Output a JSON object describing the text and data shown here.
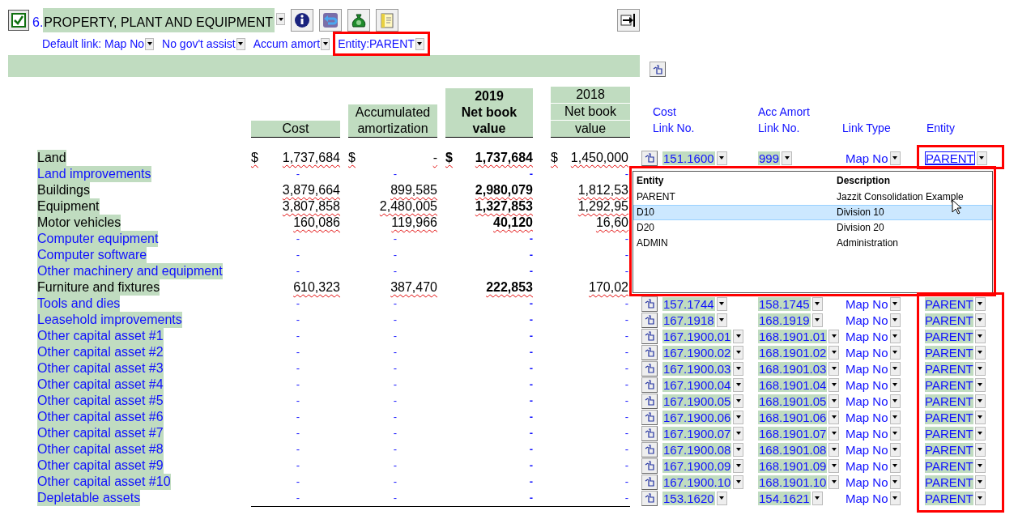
{
  "section": {
    "checked": true,
    "number": "6.",
    "title": "PROPERTY, PLANT AND EQUIPMENT"
  },
  "options": [
    {
      "label": "Default link: Map No",
      "annotated": false
    },
    {
      "label": "No gov't assist",
      "annotated": false
    },
    {
      "label": "Accum amort",
      "annotated": false
    },
    {
      "label": "Entity:PARENT",
      "annotated": true
    }
  ],
  "columns": [
    {
      "kind": "plain",
      "lines": [
        "Cost"
      ]
    },
    {
      "kind": "plain",
      "lines": [
        "Accumulated",
        "amortization"
      ]
    },
    {
      "kind": "current",
      "lines": [
        "2019",
        "Net book",
        "value"
      ]
    },
    {
      "kind": "prior",
      "lines": [
        "2018",
        "Net book",
        "value"
      ]
    }
  ],
  "entity_column_annotated": true,
  "link_columns": [
    {
      "lines": [
        "Cost",
        "Link No."
      ]
    },
    {
      "lines": [
        "Acc Amort",
        "Link No."
      ]
    },
    {
      "lines": [
        "Link Type"
      ]
    },
    {
      "lines": [
        "Entity"
      ]
    }
  ],
  "rows": [
    {
      "name": "Land",
      "filled": true,
      "symbols": [
        "$",
        "$",
        "$",
        "$"
      ],
      "cells": [
        "1,737,684",
        "-",
        "1,737,684",
        "1,450,000"
      ],
      "links": {
        "cost": "151.1600",
        "amort": "999",
        "type": "Map No",
        "entity": "PARENT",
        "focused": true,
        "annotated": true
      }
    },
    {
      "name": "Land improvements",
      "filled": false,
      "cells": [
        "-",
        "-",
        "-",
        "-"
      ]
    },
    {
      "name": "Buildings",
      "filled": true,
      "cells": [
        "3,879,664",
        "899,585",
        "2,980,079",
        "1,812,53"
      ]
    },
    {
      "name": "Equipment",
      "filled": true,
      "cells": [
        "3,807,858",
        "2,480,005",
        "1,327,853",
        "1,292,95"
      ]
    },
    {
      "name": "Motor vehicles",
      "filled": true,
      "cells": [
        "160,086",
        "119,966",
        "40,120",
        "16,60"
      ]
    },
    {
      "name": "Computer equipment",
      "filled": false,
      "cells": [
        "-",
        "-",
        "-",
        "-"
      ]
    },
    {
      "name": "Computer software",
      "filled": false,
      "cells": [
        "-",
        "-",
        "-",
        "-"
      ]
    },
    {
      "name": "Other machinery and equipment",
      "filled": false,
      "cells": [
        "-",
        "-",
        "-",
        "-"
      ]
    },
    {
      "name": "Furniture and fixtures",
      "filled": true,
      "cells": [
        "610,323",
        "387,470",
        "222,853",
        "170,02"
      ]
    },
    {
      "name": "Tools and dies",
      "filled": false,
      "cells": [
        "-",
        "-",
        "-",
        "-"
      ],
      "links": {
        "cost": "157.1744",
        "amort": "158.1745",
        "type": "Map No",
        "entity": "PARENT"
      }
    },
    {
      "name": "Leasehold improvements",
      "filled": false,
      "cells": [
        "-",
        "-",
        "-",
        "-"
      ],
      "links": {
        "cost": "167.1918",
        "amort": "168.1919",
        "type": "Map No",
        "entity": "PARENT"
      }
    },
    {
      "name": "Other capital asset #1",
      "filled": false,
      "cells": [
        "-",
        "-",
        "-",
        "-"
      ],
      "links": {
        "cost": "167.1900.01",
        "amort": "168.1901.01",
        "type": "Map No",
        "entity": "PARENT"
      }
    },
    {
      "name": "Other capital asset #2",
      "filled": false,
      "cells": [
        "-",
        "-",
        "-",
        "-"
      ],
      "links": {
        "cost": "167.1900.02",
        "amort": "168.1901.02",
        "type": "Map No",
        "entity": "PARENT"
      }
    },
    {
      "name": "Other capital asset #3",
      "filled": false,
      "cells": [
        "-",
        "-",
        "-",
        "-"
      ],
      "links": {
        "cost": "167.1900.03",
        "amort": "168.1901.03",
        "type": "Map No",
        "entity": "PARENT"
      }
    },
    {
      "name": "Other capital asset #4",
      "filled": false,
      "cells": [
        "-",
        "-",
        "-",
        "-"
      ],
      "links": {
        "cost": "167.1900.04",
        "amort": "168.1901.04",
        "type": "Map No",
        "entity": "PARENT"
      }
    },
    {
      "name": "Other capital asset #5",
      "filled": false,
      "cells": [
        "-",
        "-",
        "-",
        "-"
      ],
      "links": {
        "cost": "167.1900.05",
        "amort": "168.1901.05",
        "type": "Map No",
        "entity": "PARENT"
      }
    },
    {
      "name": "Other capital asset #6",
      "filled": false,
      "cells": [
        "-",
        "-",
        "-",
        "-"
      ],
      "links": {
        "cost": "167.1900.06",
        "amort": "168.1901.06",
        "type": "Map No",
        "entity": "PARENT"
      }
    },
    {
      "name": "Other capital asset #7",
      "filled": false,
      "cells": [
        "-",
        "-",
        "-",
        "-"
      ],
      "links": {
        "cost": "167.1900.07",
        "amort": "168.1901.07",
        "type": "Map No",
        "entity": "PARENT"
      }
    },
    {
      "name": "Other capital asset #8",
      "filled": false,
      "cells": [
        "-",
        "-",
        "-",
        "-"
      ],
      "links": {
        "cost": "167.1900.08",
        "amort": "168.1901.08",
        "type": "Map No",
        "entity": "PARENT"
      }
    },
    {
      "name": "Other capital asset #9",
      "filled": false,
      "cells": [
        "-",
        "-",
        "-",
        "-"
      ],
      "links": {
        "cost": "167.1900.09",
        "amort": "168.1901.09",
        "type": "Map No",
        "entity": "PARENT"
      }
    },
    {
      "name": "Other capital asset #10",
      "filled": false,
      "cells": [
        "-",
        "-",
        "-",
        "-"
      ],
      "links": {
        "cost": "167.1900.10",
        "amort": "168.1901.10",
        "type": "Map No",
        "entity": "PARENT"
      }
    },
    {
      "name": "Depletable assets",
      "filled": false,
      "cells": [
        "-",
        "-",
        "-",
        "-"
      ],
      "links": {
        "cost": "153.1620",
        "amort": "154.1621",
        "type": "Map No",
        "entity": "PARENT"
      }
    }
  ],
  "entity_dropdown": {
    "annotated": true,
    "columns": [
      "Entity",
      "Description"
    ],
    "items": [
      {
        "entity": "PARENT",
        "description": "Jazzit Consolidation Example",
        "selected": false
      },
      {
        "entity": "D10",
        "description": "Division 10",
        "selected": true
      },
      {
        "entity": "D20",
        "description": "Division 20",
        "selected": false
      },
      {
        "entity": "ADMIN",
        "description": "Administration",
        "selected": false
      }
    ]
  }
}
